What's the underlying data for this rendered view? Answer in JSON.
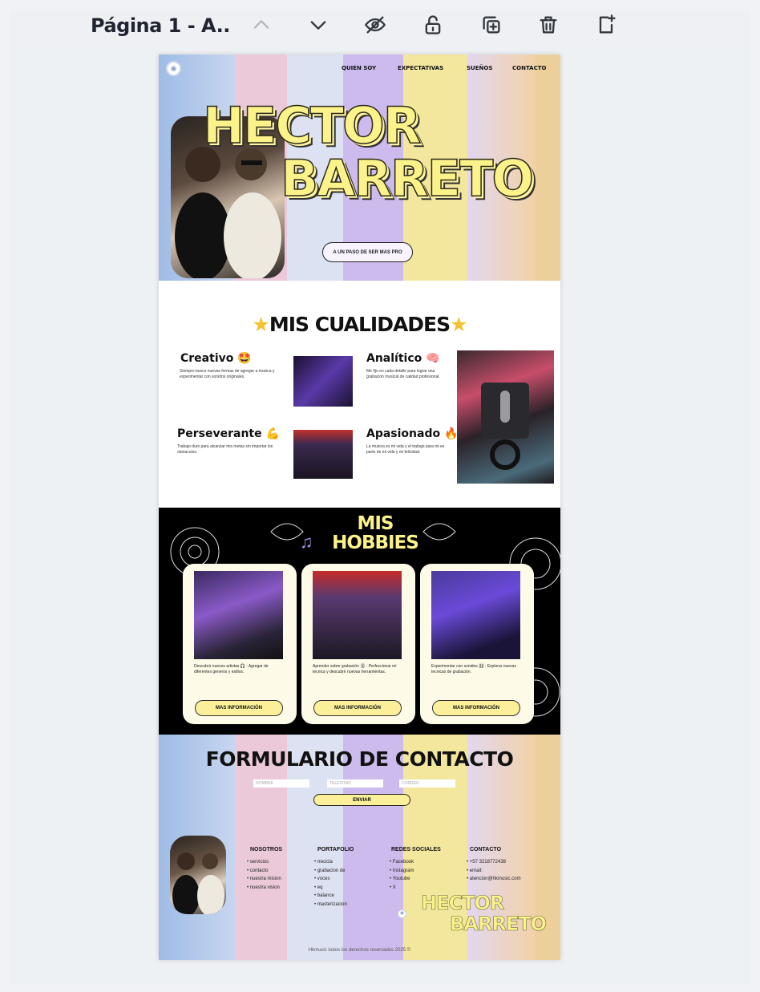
{
  "toolbar": {
    "page_label": "Página 1 - A..",
    "icons": [
      "chevron-up-icon",
      "chevron-down-icon",
      "eye-off-icon",
      "lock-open-icon",
      "duplicate-icon",
      "trash-icon",
      "add-page-icon"
    ]
  },
  "nav": {
    "items": [
      "QUIEN SOY",
      "EXPECTATIVAS",
      "SUEÑOS",
      "CONTACTO"
    ]
  },
  "hero": {
    "title_line1": "HECTOR",
    "title_line2": "BARRETO",
    "button_label": "A UN PASO DE SER MAS PRO"
  },
  "qualities": {
    "title": "MIS CUALIDADES",
    "items": [
      {
        "title": "Creativo 🤩",
        "text": "Siempre busco nuevas formas de agregar a musica y experimentar con sonidos originales."
      },
      {
        "title": "Analítico 🧠",
        "text": "Me fijo en cada detalle para lograr una grabacion musical de calidad profesional."
      },
      {
        "title": "Perseverante 💪",
        "text": "Trabajo duro para alcanzar mis metas sin importar los obstaculos."
      },
      {
        "title": "Apasionado 🔥",
        "text": "La musica es mi vida y el trabajo para mi es parte de mi vida y mi felicidad."
      }
    ]
  },
  "hobbies": {
    "title_line1": "MIS",
    "title_line2": "HOBBIES",
    "cards": [
      {
        "text": "Descubrir nuevos artistas 🎧 : Agregar de diferentes generos y estilos.",
        "button": "MAS INFORMACIÓN"
      },
      {
        "text": "Aprender sobre grabación 🎚 : Perfeccionar mi tecnica y descubrir nuevas herramientas.",
        "button": "MAS INFORMACIÓN"
      },
      {
        "text": "Experimentar con sonidos 🎛 : Explorar nuevas tecnicas de grabación.",
        "button": "MAS INFORMACIÓN"
      }
    ]
  },
  "contact": {
    "title": "FORMULARIO DE CONTACTO",
    "fields": [
      "NOMBRE",
      "TELEFONO",
      "CORREO"
    ],
    "submit": "ENVIAR"
  },
  "footer": {
    "columns": [
      {
        "heading": "NOSOTROS",
        "items": [
          "servicios",
          "contacto",
          "nuestra mision",
          "nuestra vision"
        ]
      },
      {
        "heading": "PORTAFOLIO",
        "items": [
          "mezcla",
          "grabacion de",
          "voces",
          "eq",
          "balance",
          "masterizacion"
        ]
      },
      {
        "heading": "REDES SOCIALES",
        "items": [
          "Facebook",
          "Instagram",
          "Youtube",
          "X"
        ]
      },
      {
        "heading": "CONTACTO",
        "items": [
          "+57 3218772438",
          "email:",
          "atencion@hkmusic.com"
        ]
      }
    ],
    "brand_line1": "HECTOR",
    "brand_line2": "BARRETO",
    "copyright": "Hkmusic todos los derechos reservados 2025 ©"
  }
}
